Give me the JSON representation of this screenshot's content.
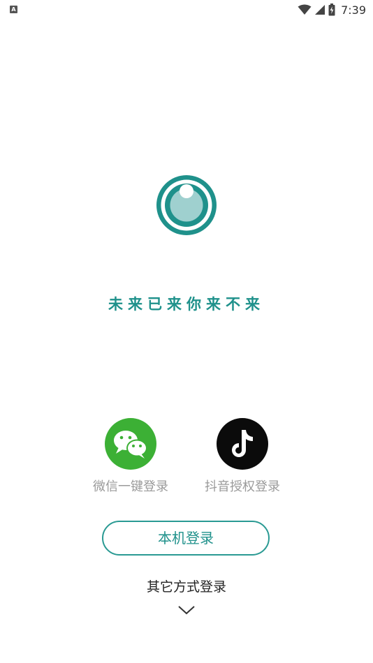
{
  "status_bar": {
    "notification_badge": "A",
    "time": "7:39",
    "icons": [
      "wifi-icon",
      "cell-signal-icon",
      "battery-charging-icon"
    ]
  },
  "logo": {
    "icon": "eye-ring-logo",
    "colors": {
      "ring": "#1f918b",
      "pupil": "#9fd0cf"
    }
  },
  "slogan": "未来已来你来不来",
  "social_login": {
    "wechat": {
      "label": "微信一键登录",
      "icon": "wechat-icon",
      "color": "#3cb035"
    },
    "douyin": {
      "label": "抖音授权登录",
      "icon": "douyin-icon",
      "color": "#0b0b0b"
    }
  },
  "local_login": {
    "label": "本机登录",
    "accent": "#2a9a93"
  },
  "other_login": {
    "label": "其它方式登录",
    "icon": "chevron-down-icon"
  }
}
